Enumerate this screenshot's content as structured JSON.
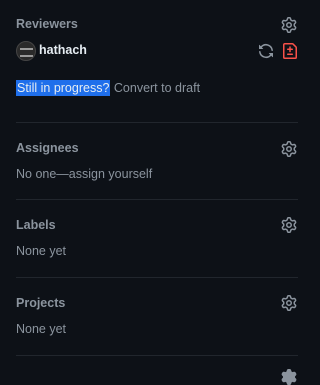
{
  "reviewers": {
    "title": "Reviewers",
    "reviewer_name": "hathach",
    "draft_prompt": "Still in progress?",
    "convert_link": "Convert to draft"
  },
  "assignees": {
    "title": "Assignees",
    "empty_text": "No one—assign yourself"
  },
  "labels": {
    "title": "Labels",
    "empty_text": "None yet"
  },
  "projects": {
    "title": "Projects",
    "empty_text": "None yet"
  },
  "icons": {
    "settings": "gear-icon",
    "re_request": "sync-icon",
    "changes_requested": "file-diff-icon"
  },
  "colors": {
    "background": "#0d1117",
    "muted": "#8b949e",
    "selection": "#1f6feb",
    "danger": "#f85149"
  }
}
